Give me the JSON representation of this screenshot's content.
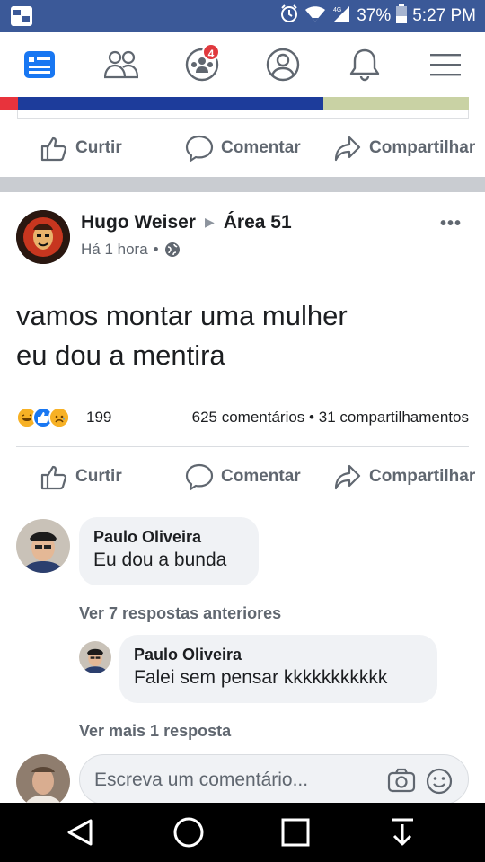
{
  "status_bar": {
    "battery": "37%",
    "time": "5:27 PM",
    "network": "4G"
  },
  "nav": {
    "items": [
      {
        "name": "news-feed",
        "icon": "news-feed-icon",
        "active": true
      },
      {
        "name": "friends",
        "icon": "friends-icon"
      },
      {
        "name": "groups",
        "icon": "groups-icon",
        "badge": "4"
      },
      {
        "name": "profile",
        "icon": "profile-icon"
      },
      {
        "name": "notifications",
        "icon": "bell-icon"
      },
      {
        "name": "menu",
        "icon": "hamburger-icon"
      }
    ],
    "accent": "#3b5998"
  },
  "prev_post": {
    "like": "Curtir",
    "comment": "Comentar",
    "share": "Compartilhar"
  },
  "post": {
    "author": "Hugo Weiser",
    "group": "Área 51",
    "time": "Há 1 hora",
    "separator": "•",
    "more": "•••",
    "text_line1": "vamos montar uma mulher",
    "text_line2": "eu dou a mentira",
    "reaction_count": "199",
    "comments_count": "625 comentários",
    "dot": "•",
    "shares_count": "31 compartilhamentos",
    "like": "Curtir",
    "comment": "Comentar",
    "share": "Compartilhar"
  },
  "comments": {
    "first": {
      "name": "Paulo Oliveira",
      "text": "Eu dou a bunda"
    },
    "previous_replies": "Ver 7 respostas anteriores",
    "reply": {
      "name": "Paulo Oliveira",
      "text": "Falei sem pensar kkkkkkkkkkk"
    },
    "more_replies": "Ver mais 1 resposta",
    "input_placeholder": "Escreva um comentário..."
  },
  "colors": {
    "facebook_blue": "#3b5998",
    "text_gray": "#606770",
    "badge_red": "#e0393e"
  }
}
